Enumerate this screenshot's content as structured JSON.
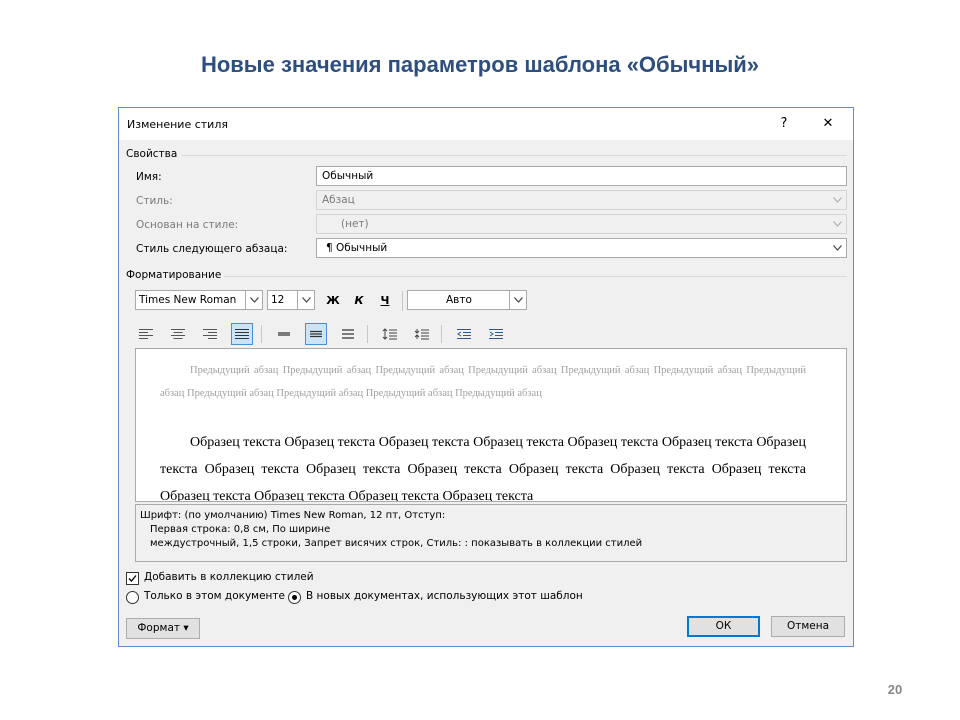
{
  "slide": {
    "title": "Новые значения параметров шаблона «Обычный»",
    "page_number": "20"
  },
  "dialog": {
    "title": "Изменение стиля",
    "help_label": "?",
    "close_label": "✕",
    "properties": {
      "group_label": "Свойства",
      "name_label": "Имя:",
      "name_value": "Обычный",
      "style_label": "Стиль:",
      "style_value": "Абзац",
      "based_on_label": "Основан на стиле:",
      "based_on_value": "(нет)",
      "next_style_label": "Стиль следующего абзаца:",
      "next_style_value": "¶  Обычный"
    },
    "formatting": {
      "group_label": "Форматирование",
      "font": "Times New Roman",
      "size": "12",
      "bold": "Ж",
      "italic": "К",
      "underline": "Ч",
      "color": "Авто"
    },
    "preview": {
      "previous_paragraph": "Предыдущий абзац Предыдущий абзац Предыдущий абзац Предыдущий абзац Предыдущий абзац Предыдущий абзац Предыдущий абзац Предыдущий абзац Предыдущий абзац Предыдущий абзац Предыдущий абзац",
      "sample_text": "Образец текста Образец текста Образец текста Образец текста Образец текста Образец текста Образец текста Образец текста Образец текста Образец текста Образец текста Образец текста Образец текста Образец текста Образец текста Образец текста Образец текста"
    },
    "description": {
      "line1": "Шрифт: (по умолчанию) Times New Roman, 12 пт, Отступ:",
      "line2": "Первая строка:  0,8 см, По ширине",
      "line3": "междустрочный,  1,5 строки, Запрет висячих строк, Стиль: : показывать в коллекции стилей"
    },
    "options": {
      "add_to_gallery_label": "Добавить в коллекцию стилей",
      "add_to_gallery_checked": true,
      "only_this_doc_label": "Только в этом документе",
      "new_docs_label": "В новых документах, использующих этот шаблон",
      "selected": "new_docs"
    },
    "buttons": {
      "format": "Формат ▾",
      "ok": "ОК",
      "cancel": "Отмена"
    }
  }
}
